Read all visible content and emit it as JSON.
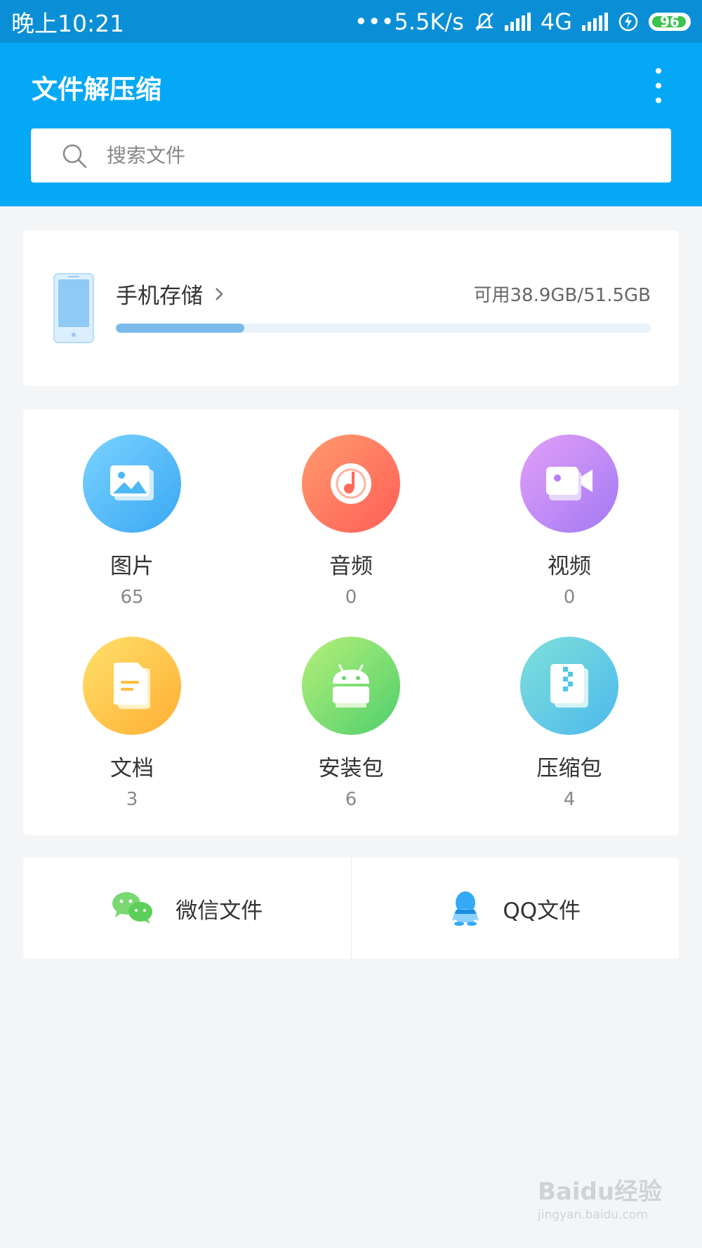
{
  "status_bar": {
    "time": "晚上10:21",
    "network_speed": "•••5.5K/s",
    "network_type": "4G",
    "battery": "96"
  },
  "app": {
    "title": "文件解压缩",
    "menu_icon": "more-vertical-icon"
  },
  "search": {
    "placeholder": "搜索文件",
    "icon": "search-icon"
  },
  "storage": {
    "title": "手机存储",
    "free_text": "可用38.9GB/51.5GB",
    "used_fraction": 0.24
  },
  "categories": [
    {
      "label": "图片",
      "count": "65",
      "icon": "image-icon",
      "color": "#4cb8f5"
    },
    {
      "label": "音频",
      "count": "0",
      "icon": "music-icon",
      "color": "#ff7a5c"
    },
    {
      "label": "视频",
      "count": "0",
      "icon": "video-icon",
      "color": "#b77ef5"
    },
    {
      "label": "文档",
      "count": "3",
      "icon": "document-icon",
      "color": "#ffbd3b"
    },
    {
      "label": "安装包",
      "count": "6",
      "icon": "android-icon",
      "color": "#6ed86b"
    },
    {
      "label": "压缩包",
      "count": "4",
      "icon": "zip-icon",
      "color": "#4ec9e6"
    }
  ],
  "links": [
    {
      "label": "微信文件",
      "icon": "wechat-icon"
    },
    {
      "label": "QQ文件",
      "icon": "qq-icon"
    }
  ],
  "watermark": {
    "text": "Baidu经验",
    "sub": "jingyan.baidu.com"
  }
}
